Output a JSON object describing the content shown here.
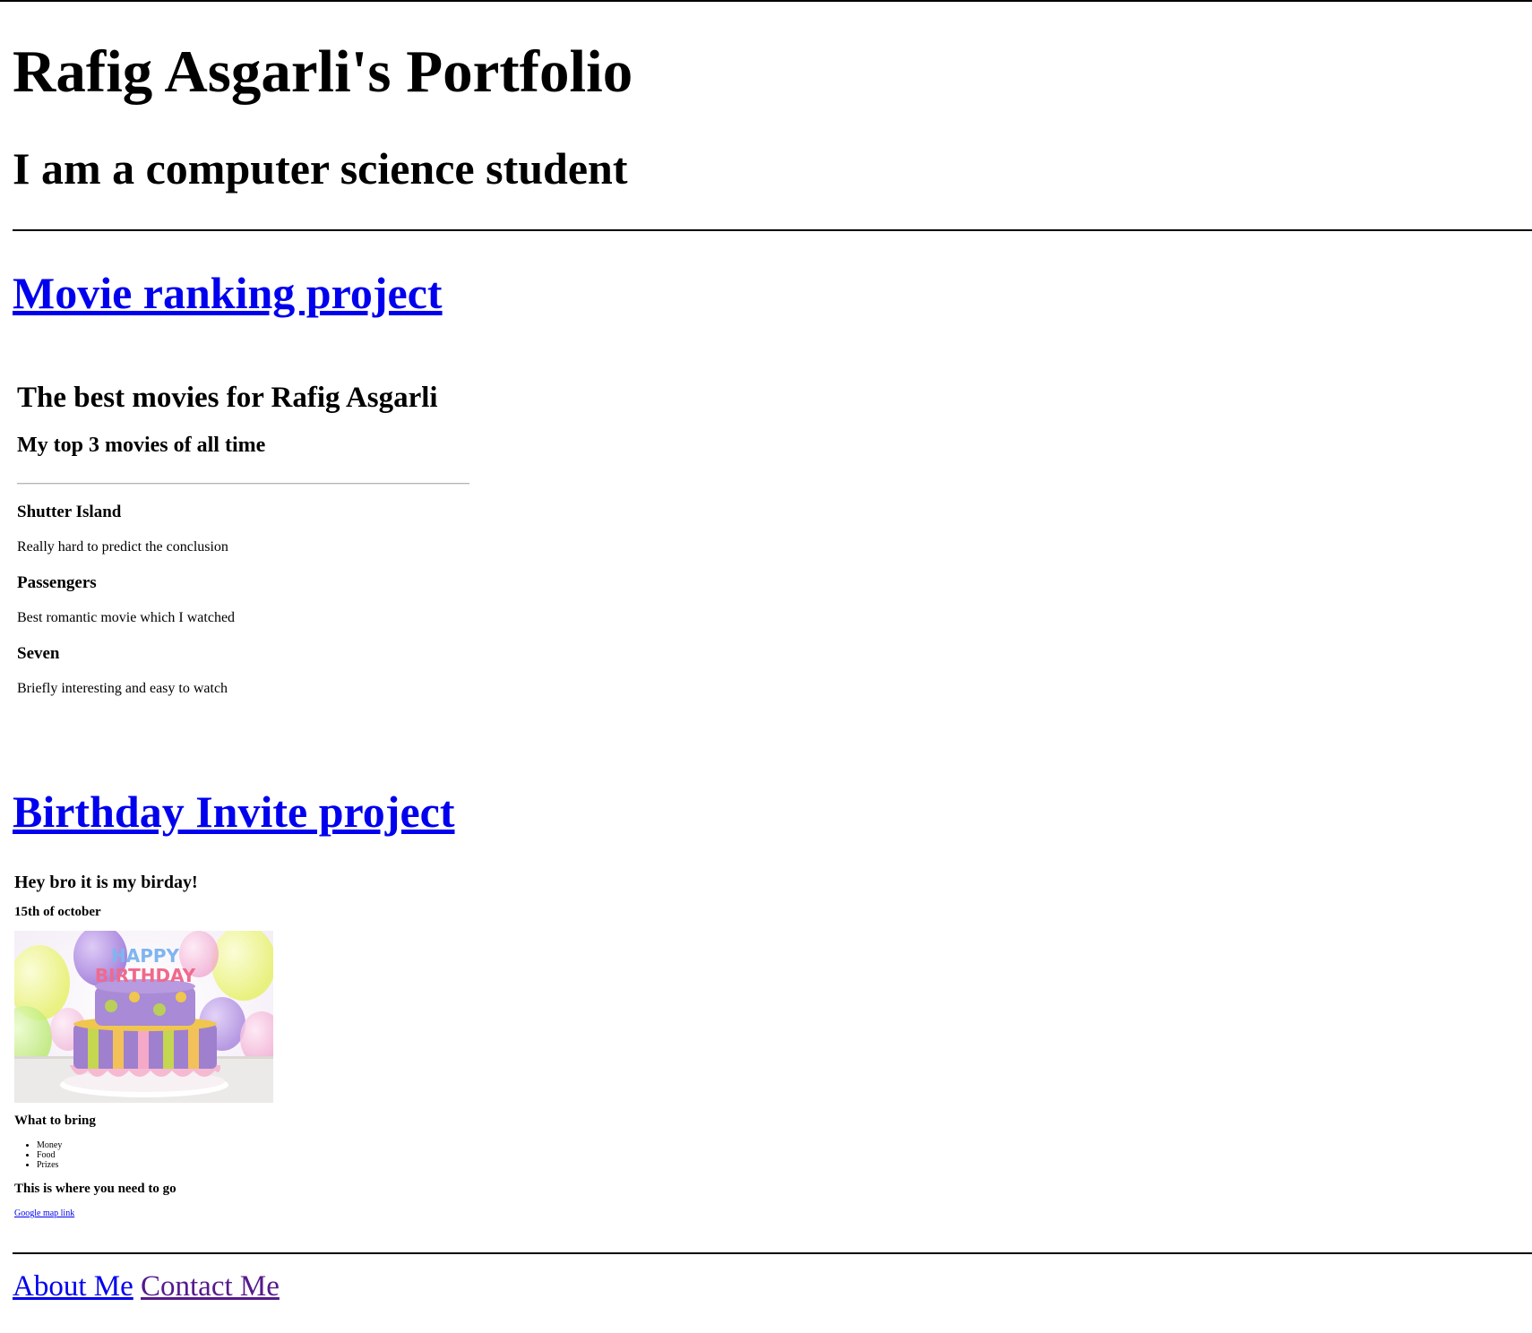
{
  "header": {
    "title": "Rafig Asgarli's Portfolio",
    "subtitle": "I am a computer science student"
  },
  "projects": [
    {
      "link_label": "Movie ranking project",
      "embed": {
        "title": "The best movies for Rafig Asgarli",
        "subtitle": "My top 3 movies of all time",
        "movies": [
          {
            "name": "Shutter Island",
            "description": "Really hard to predict the conclusion"
          },
          {
            "name": "Passengers",
            "description": "Best romantic movie which I watched"
          },
          {
            "name": "Seven",
            "description": "Briefly interesting and easy to watch"
          }
        ]
      }
    },
    {
      "link_label": "Birthday Invite project",
      "embed": {
        "title": "Hey bro it is my birday!",
        "date": "15th of october",
        "image_alt": "birthday-cake-image",
        "image_letters": [
          "HAPPY",
          "BIRTHDAY"
        ],
        "bring_heading": "What to bring",
        "bring_items": [
          "Money",
          "Food",
          "Prizes"
        ],
        "where_heading": "This is where you need to go",
        "map_link": "Google map link"
      }
    }
  ],
  "footer": {
    "about_label": "About Me",
    "contact_label": "Contact Me"
  },
  "colors": {
    "link": "#0000ee",
    "visited_link": "#551a8b"
  }
}
